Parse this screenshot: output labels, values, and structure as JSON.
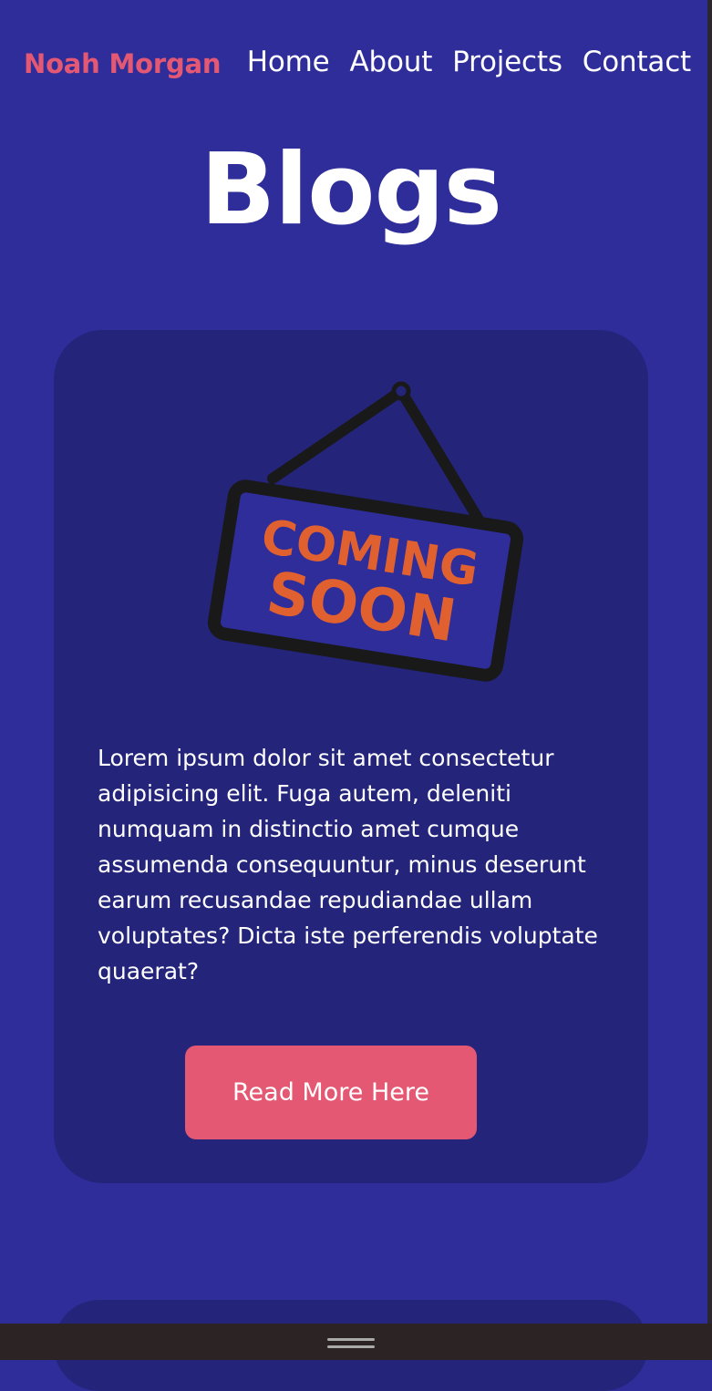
{
  "header": {
    "brand": "Noah Morgan",
    "nav": [
      "Home",
      "About",
      "Projects",
      "Contact"
    ]
  },
  "page": {
    "title": "Blogs"
  },
  "blog_cards": [
    {
      "image": {
        "icon": "coming-soon-sign",
        "line1": "COMING",
        "line2": "SOON"
      },
      "text": "Lorem ipsum dolor sit amet consectetur adipisicing elit. Fuga autem, deleniti numquam in distinctio amet cumque assumenda consequuntur, minus deserunt earum recusandae repudiandae ullam voluptates? Dicta iste perferendis voluptate quaerat?",
      "button": "Read More Here"
    }
  ],
  "colors": {
    "background": "#2e2d9a",
    "card": "#24247b",
    "accent": "#e45873",
    "sign_text": "#e0612f",
    "text": "#ffffff"
  }
}
